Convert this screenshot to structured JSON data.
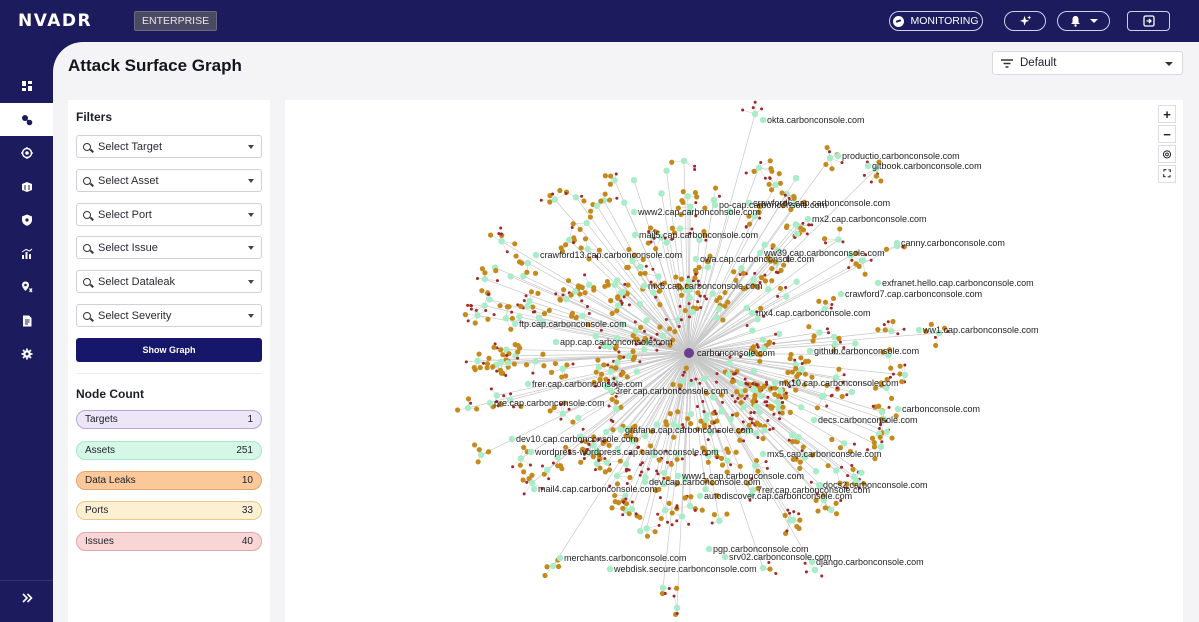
{
  "app": {
    "brand": "NVADR",
    "edition": "ENTERPRISE"
  },
  "topbar": {
    "monitoring_label": "MONITORING",
    "ai_icon": "sparkles-icon",
    "bell_icon": "bell-icon",
    "logout_icon": "logout-icon"
  },
  "sidebar": {
    "items": [
      {
        "icon": "dashboard-icon",
        "active": false
      },
      {
        "icon": "attack-surface-icon",
        "active": true
      },
      {
        "icon": "target-icon",
        "active": false
      },
      {
        "icon": "assets-icon",
        "active": false
      },
      {
        "icon": "shield-icon",
        "active": false
      },
      {
        "icon": "analytics-icon",
        "active": false
      },
      {
        "icon": "location-icon",
        "active": false
      },
      {
        "icon": "report-icon",
        "active": false
      },
      {
        "icon": "settings-icon",
        "active": false
      }
    ],
    "expand_icon": "double-chevron-right-icon"
  },
  "page": {
    "title": "Attack Surface Graph",
    "view_select": "Default"
  },
  "filters": {
    "title": "Filters",
    "selects": [
      {
        "placeholder": "Select Target"
      },
      {
        "placeholder": "Select Asset"
      },
      {
        "placeholder": "Select Port"
      },
      {
        "placeholder": "Select Issue"
      },
      {
        "placeholder": "Select Dataleak"
      },
      {
        "placeholder": "Select Severity"
      }
    ],
    "show_graph_label": "Show Graph"
  },
  "node_count": {
    "title": "Node Count",
    "items": [
      {
        "label": "Targets",
        "count": "1",
        "bg": "#ece6f7",
        "border": "#b7a6d8"
      },
      {
        "label": "Assets",
        "count": "251",
        "bg": "#d4f7e6",
        "border": "#a8e6c8"
      },
      {
        "label": "Data Leaks",
        "count": "10",
        "bg": "#fbc89a",
        "border": "#e2a472"
      },
      {
        "label": "Ports",
        "count": "33",
        "bg": "#fcefd2",
        "border": "#e6c889"
      },
      {
        "label": "Issues",
        "count": "40",
        "bg": "#f8d6d6",
        "border": "#e0a8a8"
      }
    ]
  },
  "graph": {
    "zoom_controls": [
      "+",
      "−",
      "◎",
      "⛶"
    ],
    "colors": {
      "target": "#6a3d8f",
      "asset": "#a8ecc8",
      "port": "#c48a1c",
      "issue": "#a0282a",
      "edge": "#c8c8c8"
    },
    "center_label": "carbonconsole.com",
    "labels": [
      "okta.carbonconsole.com",
      "productio.carbonconsole.com",
      "gitbook.carbonconsole.com",
      "po-cap.carbonconsole.com",
      "crawford6.cap.carbonconsole.com",
      "www2.cap.carbonconsole.com",
      "mx2.cap.carbonconsole.com",
      "mail5.cap.carbonconsole.com",
      "canny.carbonconsole.com",
      "crawford13.cap.carbonconsole.com",
      "owa.cap.carbonconsole.com",
      "ww39.cap.carbonconsole.com",
      "exfranet.hello.cap.carbonconsole.com",
      "mx6.cap.carbonconsole.com",
      "crawford7.cap.carbonconsole.com",
      "mx4.cap.carbonconsole.com",
      "ftp.cap.carbonconsole.com",
      "ww1.cap.carbonconsole.com",
      "app.cap.carbonconsole.com",
      "github.carbonconsole.com",
      "frer.cap.carbonconsole.com",
      "mx10.cap.carbonconsole.com",
      "3rer.cap.carbonconsole.com",
      "pre.cap.carbonconsole.com",
      "carbonconsole.com",
      "decs.carbonconsole.com",
      "grafana.cap.carbonconsole.com",
      "dev10.cap.carbonconsole.com",
      "wordpress-wordpress.cap.carbonconsole.com",
      "mx5.cap.carbonconsole.com",
      "www1.cap.carbonconsole.com",
      "dev.cap.carbonconsole.com",
      "docs2.carbonconsole.com",
      "mail4.cap.carbonconsole.com",
      "7rer.cap.carbonconsole.com",
      "autodiscover.cap.carbonconsole.com",
      "pgp.carbonconsole.com",
      "merchants.carbonconsole.com",
      "srv02.carbonconsole.com",
      "django.carbonconsole.com",
      "webdisk.secure.carbonconsole.com"
    ]
  }
}
